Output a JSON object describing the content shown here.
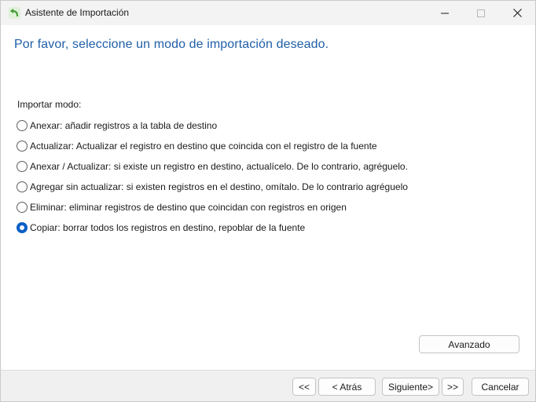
{
  "window": {
    "title": "Asistente de Importación",
    "icon": "import-wizard-icon"
  },
  "heading": "Por favor, seleccione un modo de importación deseado.",
  "mode_label": "Importar modo:",
  "options": [
    {
      "label": "Anexar: añadir registros a la tabla de destino",
      "checked": false
    },
    {
      "label": "Actualizar: Actualizar el registro en destino que coincida con el registro de la fuente",
      "checked": false
    },
    {
      "label": "Anexar / Actualizar: si existe un registro en destino, actualícelo. De lo contrario, agréguelo.",
      "checked": false
    },
    {
      "label": "Agregar sin actualizar: si existen registros en el destino, omítalo. De lo contrario agréguelo",
      "checked": false
    },
    {
      "label": "Eliminar: eliminar registros de destino que coincidan con registros en origen",
      "checked": false
    },
    {
      "label": "Copiar: borrar todos los registros en destino, repoblar de la fuente",
      "checked": true
    }
  ],
  "buttons": {
    "advanced": "Avanzado",
    "first": "<<",
    "back": "< Atrás",
    "next": "Siguiente>",
    "last": ">>",
    "cancel": "Cancelar"
  },
  "colors": {
    "heading": "#1f5fa8",
    "radio_selected": "#0a5fc6",
    "footer_bg": "#f0f0f0"
  }
}
